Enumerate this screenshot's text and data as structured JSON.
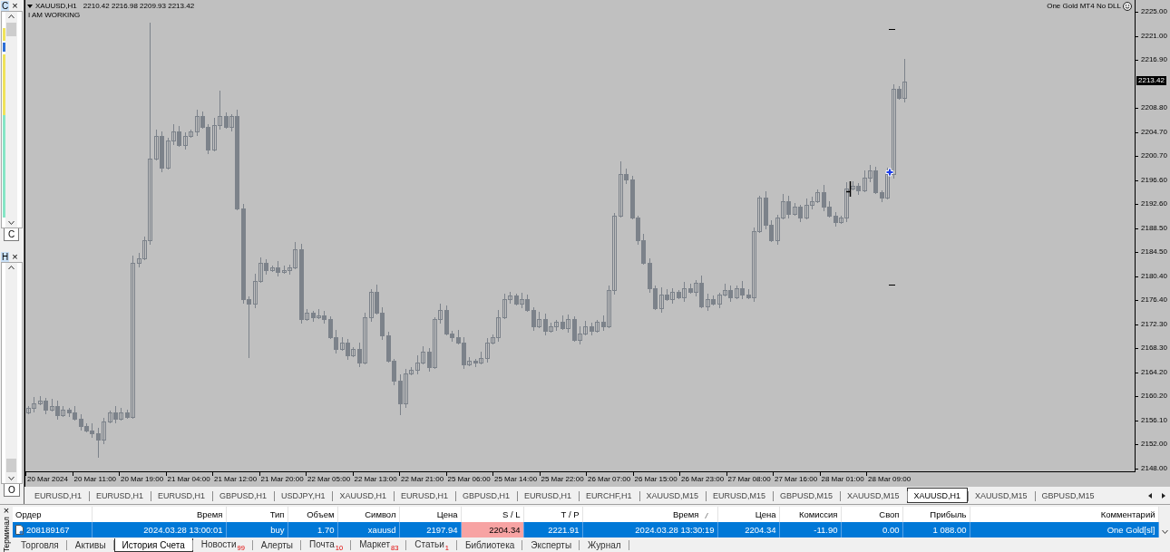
{
  "side_panels": [
    {
      "title": "C",
      "close": "×",
      "color_strip": true,
      "tab": "C"
    },
    {
      "title": "H",
      "close": "×",
      "color_strip": false,
      "tab": "O"
    }
  ],
  "chart": {
    "symbol": "XAUUSD,H1",
    "ohlc": "2210.42 2216.98 2209.93 2213.42",
    "status": "I AM WORKING",
    "expert": "One Gold MT4 No DLL",
    "price_axis": [
      {
        "kind": "tick",
        "label": "2225.00"
      },
      {
        "kind": "tick",
        "label": "2221.00"
      },
      {
        "kind": "tick",
        "label": "2216.90"
      },
      {
        "kind": "current",
        "label": "2213.42"
      },
      {
        "kind": "tick",
        "label": "2208.80"
      },
      {
        "kind": "tick",
        "label": "2204.70"
      },
      {
        "kind": "tick",
        "label": "2200.70"
      },
      {
        "kind": "tick",
        "label": "2196.60"
      },
      {
        "kind": "tick",
        "label": "2192.60"
      },
      {
        "kind": "tick",
        "label": "2188.50"
      },
      {
        "kind": "tick",
        "label": "2184.50"
      },
      {
        "kind": "tick",
        "label": "2180.40"
      },
      {
        "kind": "tick",
        "label": "2176.40"
      },
      {
        "kind": "tick",
        "label": "2172.30"
      },
      {
        "kind": "tick",
        "label": "2168.30"
      },
      {
        "kind": "tick",
        "label": "2164.20"
      },
      {
        "kind": "tick",
        "label": "2160.20"
      },
      {
        "kind": "tick",
        "label": "2156.10"
      },
      {
        "kind": "tick",
        "label": "2152.00"
      },
      {
        "kind": "tick",
        "label": "2148.00"
      }
    ],
    "time_axis": [
      "20 Mar 2024",
      "20 Mar 11:00",
      "20 Mar 19:00",
      "21 Mar 04:00",
      "21 Mar 12:00",
      "21 Mar 20:00",
      "22 Mar 05:00",
      "22 Mar 13:00",
      "22 Mar 21:00",
      "25 Mar 06:00",
      "25 Mar 14:00",
      "25 Mar 22:00",
      "26 Mar 07:00",
      "26 Mar 15:00",
      "26 Mar 23:00",
      "27 Mar 08:00",
      "27 Mar 16:00",
      "28 Mar 01:00",
      "28 Mar 09:00"
    ]
  },
  "chart_tabs": [
    {
      "label": "EURUSD,H1",
      "selected": false
    },
    {
      "label": "EURUSD,H1",
      "selected": false
    },
    {
      "label": "EURUSD,H1",
      "selected": false
    },
    {
      "label": "GBPUSD,H1",
      "selected": false
    },
    {
      "label": "USDJPY,H1",
      "selected": false
    },
    {
      "label": "XAUUSD,H1",
      "selected": false
    },
    {
      "label": "EURUSD,H1",
      "selected": false
    },
    {
      "label": "GBPUSD,H1",
      "selected": false
    },
    {
      "label": "EURUSD,H1",
      "selected": false
    },
    {
      "label": "EURCHF,H1",
      "selected": false
    },
    {
      "label": "XAUUSD,M15",
      "selected": false
    },
    {
      "label": "EURUSD,M15",
      "selected": false
    },
    {
      "label": "GBPUSD,M15",
      "selected": false
    },
    {
      "label": "XAUUSD,M15",
      "selected": false
    },
    {
      "label": "XAUUSD,H1",
      "selected": true
    },
    {
      "label": "XAUUSD,M15",
      "selected": false
    },
    {
      "label": "GBPUSD,M15",
      "selected": false
    }
  ],
  "terminal": {
    "title": "Терминал",
    "close": "×",
    "columns": [
      {
        "label": "Ордер",
        "sorted": false
      },
      {
        "label": "Время",
        "sorted": false
      },
      {
        "label": "Тип",
        "sorted": false
      },
      {
        "label": "Объем",
        "sorted": false
      },
      {
        "label": "Символ",
        "sorted": false
      },
      {
        "label": "Цена",
        "sorted": false
      },
      {
        "label": "S / L",
        "sorted": false
      },
      {
        "label": "T / P",
        "sorted": false
      },
      {
        "label": "Время",
        "sorted": true
      },
      {
        "label": "Цена",
        "sorted": false
      },
      {
        "label": "Комиссия",
        "sorted": false
      },
      {
        "label": "Своп",
        "sorted": false
      },
      {
        "label": "Прибыль",
        "sorted": false
      },
      {
        "label": "Комментарий",
        "sorted": false
      }
    ],
    "rows": [
      {
        "selected": true,
        "cells": [
          {
            "text": "208189167",
            "highlighted": false
          },
          {
            "text": "2024.03.28 13:00:01",
            "highlighted": false
          },
          {
            "text": "buy",
            "highlighted": false
          },
          {
            "text": "1.70",
            "highlighted": false
          },
          {
            "text": "xauusd",
            "highlighted": false
          },
          {
            "text": "2197.94",
            "highlighted": false
          },
          {
            "text": "2204.34",
            "highlighted": true
          },
          {
            "text": "2221.91",
            "highlighted": false
          },
          {
            "text": "2024.03.28 13:30:19",
            "highlighted": false
          },
          {
            "text": "2204.34",
            "highlighted": false
          },
          {
            "text": "-11.90",
            "highlighted": false
          },
          {
            "text": "0.00",
            "highlighted": false
          },
          {
            "text": "1 088.00",
            "highlighted": false
          },
          {
            "text": "One Gold[sl]",
            "highlighted": false
          }
        ]
      }
    ],
    "tabs": [
      {
        "label": "Торговля",
        "selected": false
      },
      {
        "label": "Активы",
        "selected": false
      },
      {
        "label": "История Счета",
        "selected": true
      },
      {
        "label": "Новости",
        "count": "99",
        "selected": false
      },
      {
        "label": "Алерты",
        "selected": false
      },
      {
        "label": "Почта",
        "count": "10",
        "selected": false
      },
      {
        "label": "Маркет",
        "count": "83",
        "selected": false
      },
      {
        "label": "Статьи",
        "count": "1",
        "selected": false
      },
      {
        "label": "Библиотека",
        "selected": false
      },
      {
        "label": "Эксперты",
        "selected": false
      },
      {
        "label": "Журнал",
        "selected": false
      }
    ]
  }
}
